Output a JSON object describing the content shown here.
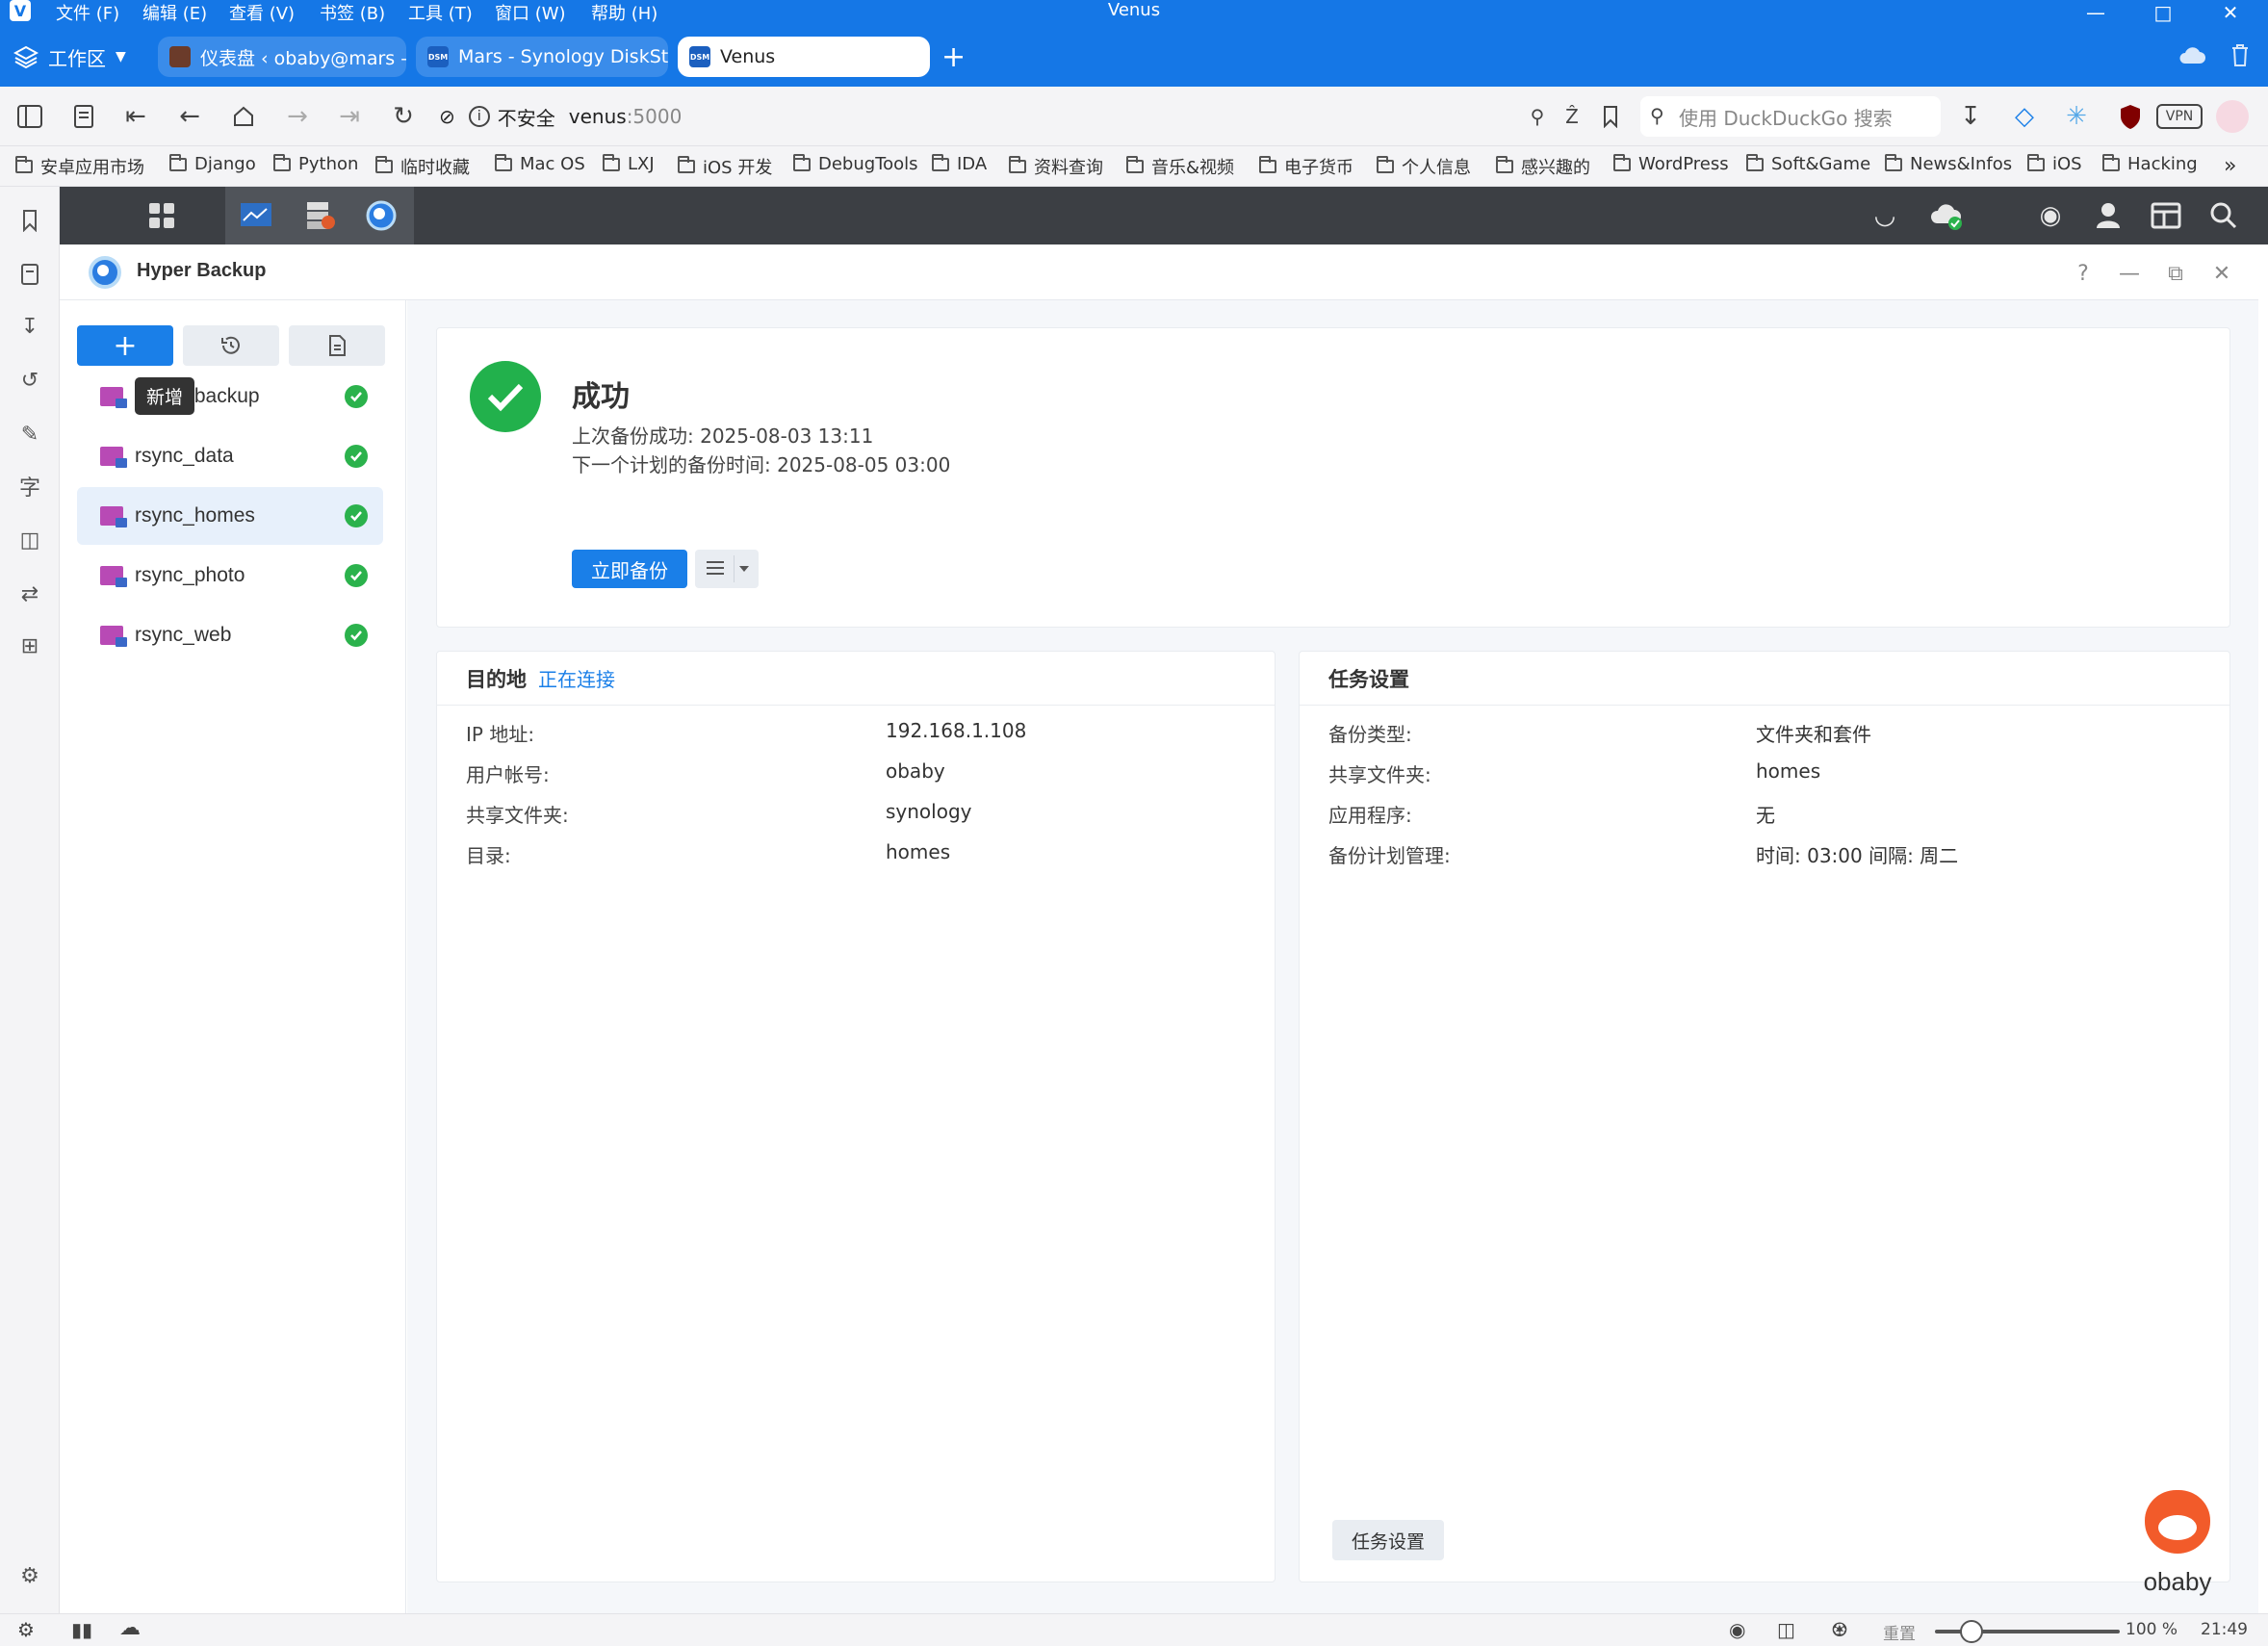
{
  "browser": {
    "window_title": "Venus",
    "menus": [
      "文件 (F)",
      "编辑 (E)",
      "查看 (V)",
      "书签 (B)",
      "工具 (T)",
      "窗口 (W)",
      "帮助 (H)"
    ],
    "workspace_label": "工作区",
    "tabs": [
      {
        "title": "仪表盘 ‹ obaby@mars — W",
        "active": false
      },
      {
        "title": "Mars - Synology DiskStation",
        "active": false
      },
      {
        "title": "Venus",
        "active": true
      }
    ],
    "tab_favicon_text": "DSM",
    "address": {
      "insecure_label": "不安全",
      "host": "venus",
      "port": ":5000"
    },
    "search_placeholder": "使用 DuckDuckGo 搜索",
    "vpn_label": "VPN",
    "bookmarks": [
      "安卓应用市场",
      "Django",
      "Python",
      "临时收藏",
      "Mac OS",
      "LXJ",
      "iOS 开发",
      "DebugTools",
      "IDA",
      "资料查询",
      "音乐&视频",
      "电子货币",
      "个人信息",
      "感兴趣的",
      "WordPress",
      "Soft&Game",
      "News&Infos",
      "iOS",
      "Hacking"
    ],
    "status": {
      "reset_label": "重置",
      "zoom": "100 %",
      "time": "21:49"
    }
  },
  "app": {
    "title": "Hyper Backup",
    "toolbar": {
      "add_label": "+",
      "tooltip": "新增"
    },
    "tasks": [
      {
        "name": "rsync_backup",
        "selected": false
      },
      {
        "name": "rsync_data",
        "selected": false
      },
      {
        "name": "rsync_homes",
        "selected": true
      },
      {
        "name": "rsync_photo",
        "selected": false
      },
      {
        "name": "rsync_web",
        "selected": false
      }
    ],
    "status": {
      "title": "成功",
      "last_backup": "上次备份成功: 2025-08-03 13:11",
      "next_backup": "下一个计划的备份时间: 2025-08-05 03:00",
      "backup_now_label": "立即备份"
    },
    "destination": {
      "heading": "目的地",
      "state": "正在连接",
      "rows": [
        {
          "label": "IP 地址:",
          "value": "192.168.1.108"
        },
        {
          "label": "用户帐号:",
          "value": "obaby"
        },
        {
          "label": "共享文件夹:",
          "value": "synology"
        },
        {
          "label": "目录:",
          "value": "homes"
        }
      ]
    },
    "task_settings": {
      "heading": "任务设置",
      "rows": [
        {
          "label": "备份类型:",
          "value": "文件夹和套件"
        },
        {
          "label": "共享文件夹:",
          "value": "homes"
        },
        {
          "label": "应用程序:",
          "value": "无"
        },
        {
          "label": "备份计划管理:",
          "value": "时间: 03:00 间隔: 周二"
        }
      ],
      "button_label": "任务设置"
    },
    "watermark": "obaby"
  },
  "colors": {
    "chrome_blue": "#1577e6",
    "primary": "#1a7fe8",
    "success": "#22b14c",
    "dsm_bar": "#3c3f44"
  }
}
